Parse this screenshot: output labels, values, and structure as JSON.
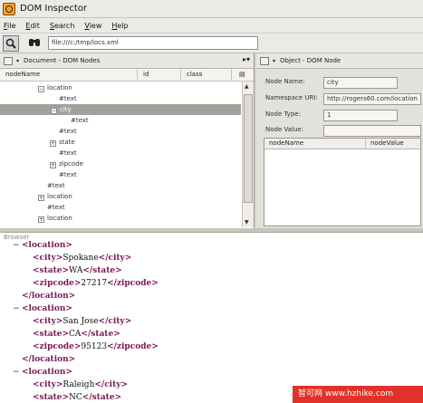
{
  "app": {
    "title": "DOM Inspector"
  },
  "menu": {
    "items": [
      {
        "u": "F",
        "rest": "ile"
      },
      {
        "u": "E",
        "rest": "dit"
      },
      {
        "u": "S",
        "rest": "earch"
      },
      {
        "u": "V",
        "rest": "iew"
      },
      {
        "u": "H",
        "rest": "elp"
      }
    ]
  },
  "toolbar": {
    "url": "file:///c:/tmp/locs.xml"
  },
  "left_pane": {
    "title": "Document - DOM Nodes",
    "columns": [
      "nodeName",
      "id",
      "class"
    ],
    "nodes": [
      {
        "label": "location",
        "twisty": "−"
      },
      {
        "label": "#text",
        "twisty": ""
      },
      {
        "label": "city",
        "twisty": "−"
      },
      {
        "label": "#text",
        "twisty": ""
      },
      {
        "label": "#text",
        "twisty": ""
      },
      {
        "label": "state",
        "twisty": "+"
      },
      {
        "label": "#text",
        "twisty": ""
      },
      {
        "label": "zipcode",
        "twisty": "+"
      },
      {
        "label": "#text",
        "twisty": ""
      },
      {
        "label": "#text",
        "twisty": ""
      },
      {
        "label": "location",
        "twisty": "+"
      },
      {
        "label": "#text",
        "twisty": ""
      },
      {
        "label": "location",
        "twisty": "+"
      }
    ]
  },
  "right_pane": {
    "title": "Object - DOM Node",
    "node_name_label": "Node Name:",
    "node_name_value": "city",
    "namespace_label": "Namespace URI:",
    "namespace_value": "http://rogers60.com/location",
    "node_type_label": "Node Type:",
    "node_type_value": "1",
    "node_value_label": "Node Value:",
    "node_value_value": "",
    "attr_columns": [
      "nodeName",
      "nodeValue"
    ]
  },
  "browser": {
    "label": "Browser",
    "lines": [
      {
        "toggle": "−",
        "parts": [
          "<location>"
        ]
      },
      {
        "toggle": "",
        "parts": [
          "<city>",
          "Spokane",
          "</city>"
        ]
      },
      {
        "toggle": "",
        "parts": [
          "<state>",
          "WA",
          "</state>"
        ]
      },
      {
        "toggle": "",
        "parts": [
          "<zipcode>",
          "27217",
          "</zipcode>"
        ]
      },
      {
        "toggle": "",
        "parts": [
          "</location>"
        ]
      },
      {
        "toggle": "−",
        "parts": [
          "<location>"
        ]
      },
      {
        "toggle": "",
        "parts": [
          "<city>",
          "San Jose",
          "</city>"
        ]
      },
      {
        "toggle": "",
        "parts": [
          "<state>",
          "CA",
          "</state>"
        ]
      },
      {
        "toggle": "",
        "parts": [
          "<zipcode>",
          "95123",
          "</zipcode>"
        ]
      },
      {
        "toggle": "",
        "parts": [
          "</location>"
        ]
      },
      {
        "toggle": "−",
        "parts": [
          "<location>"
        ]
      },
      {
        "toggle": "",
        "parts": [
          "<city>",
          "Raleigh",
          "</city>"
        ]
      },
      {
        "toggle": "",
        "parts": [
          "<state>",
          "NC",
          "</state>"
        ]
      }
    ]
  },
  "watermark": {
    "text": "智可网 www.hzhike.com"
  },
  "colors": {
    "selection": "#a4a19c",
    "tag": "#7a1a55",
    "watermark": "#e0322a"
  }
}
